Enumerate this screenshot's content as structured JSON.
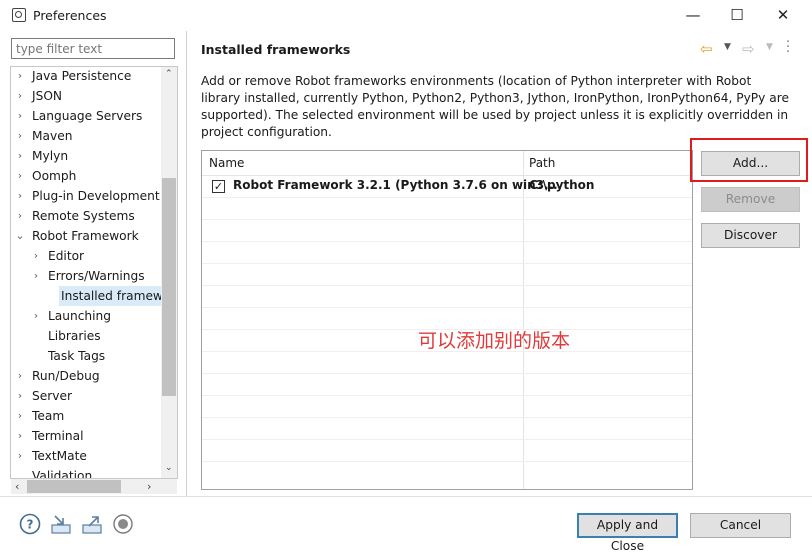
{
  "window": {
    "title": "Preferences",
    "minimize": "—",
    "maximize": "☐",
    "close": "✕"
  },
  "filter": {
    "placeholder": "type filter text"
  },
  "tree": [
    {
      "label": "Java Persistence",
      "indent": 0,
      "twisty": "›"
    },
    {
      "label": "JSON",
      "indent": 0,
      "twisty": "›"
    },
    {
      "label": "Language Servers",
      "indent": 0,
      "twisty": "›"
    },
    {
      "label": "Maven",
      "indent": 0,
      "twisty": "›"
    },
    {
      "label": "Mylyn",
      "indent": 0,
      "twisty": "›"
    },
    {
      "label": "Oomph",
      "indent": 0,
      "twisty": "›"
    },
    {
      "label": "Plug-in Development",
      "indent": 0,
      "twisty": "›"
    },
    {
      "label": "Remote Systems",
      "indent": 0,
      "twisty": "›"
    },
    {
      "label": "Robot Framework",
      "indent": 0,
      "twisty": "⌄"
    },
    {
      "label": "Editor",
      "indent": 1,
      "twisty": "›"
    },
    {
      "label": "Errors/Warnings",
      "indent": 1,
      "twisty": "›"
    },
    {
      "label": "Installed framework",
      "indent": 1,
      "twisty": "",
      "selected": true
    },
    {
      "label": "Launching",
      "indent": 1,
      "twisty": "›"
    },
    {
      "label": "Libraries",
      "indent": 1,
      "twisty": ""
    },
    {
      "label": "Task Tags",
      "indent": 1,
      "twisty": ""
    },
    {
      "label": "Run/Debug",
      "indent": 0,
      "twisty": "›"
    },
    {
      "label": "Server",
      "indent": 0,
      "twisty": "›"
    },
    {
      "label": "Team",
      "indent": 0,
      "twisty": "›"
    },
    {
      "label": "Terminal",
      "indent": 0,
      "twisty": "›"
    },
    {
      "label": "TextMate",
      "indent": 0,
      "twisty": "›"
    },
    {
      "label": "Validation",
      "indent": 0,
      "twisty": ""
    }
  ],
  "page": {
    "title": "Installed frameworks",
    "description": "Add or remove Robot frameworks environments (location of Python interpreter with Robot library installed, currently Python, Python2, Python3, Jython, IronPython, IronPython64, PyPy are supported). The selected environment will be used by project unless it is explicitly overridden in project configuration."
  },
  "table": {
    "columns": [
      "Name",
      "Path"
    ],
    "rows": [
      {
        "checked": true,
        "name": "Robot Framework 3.2.1 (Python 3.7.6 on win3...",
        "path": "C:\\python"
      }
    ]
  },
  "buttons": {
    "add": "Add...",
    "remove": "Remove",
    "discover": "Discover",
    "apply_close": "Apply and Close",
    "cancel": "Cancel"
  },
  "annotation": "可以添加别的版本",
  "colors": {
    "annotation": "#e03a3a",
    "highlight_box": "#e01b1b",
    "selection": "#d9ebf9"
  },
  "icons": [
    "help-icon",
    "import-icon",
    "export-icon",
    "record-icon",
    "back-icon",
    "forward-icon",
    "view-menu-icon"
  ]
}
